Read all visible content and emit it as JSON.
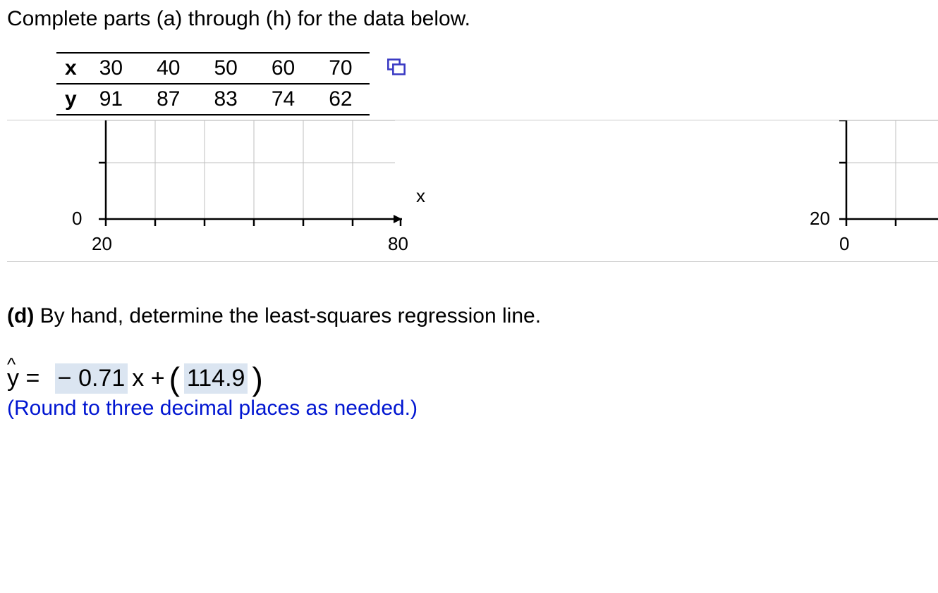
{
  "instruction": "Complete parts (a) through (h) for the data below.",
  "table": {
    "x_label": "x",
    "y_label": "y",
    "x": [
      "30",
      "40",
      "50",
      "60",
      "70"
    ],
    "y": [
      "91",
      "87",
      "83",
      "74",
      "62"
    ]
  },
  "chart_data": [
    {
      "type": "scatter",
      "xlabel": "x",
      "ylabel": "",
      "xlim": [
        20,
        80
      ],
      "xticks": [
        20,
        80
      ],
      "yticks": [
        0
      ],
      "x": [],
      "y": []
    },
    {
      "type": "scatter",
      "xlabel": "",
      "ylabel": "",
      "xlim": [
        0,
        60
      ],
      "xticks": [
        0
      ],
      "yticks": [
        20
      ],
      "x": [],
      "y": []
    }
  ],
  "part_d": {
    "label": "(d)",
    "text": "By hand, determine the least-squares regression line.",
    "eq_prefix": "y =",
    "slope": "− 0.71",
    "mid": "x +",
    "intercept": "114.9",
    "rounding": "(Round to three decimal places as needed.)"
  },
  "axis": {
    "left_y0": "0",
    "left_x1": "20",
    "left_x2": "80",
    "left_xlab": "x",
    "right_y": "20",
    "right_x": "0"
  }
}
